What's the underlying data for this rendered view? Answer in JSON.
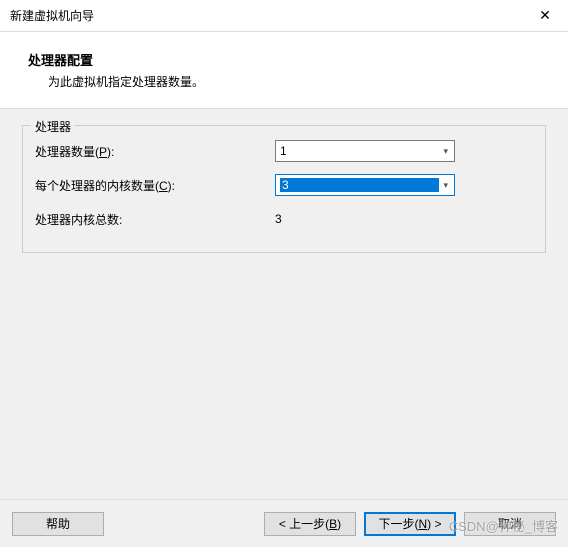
{
  "window": {
    "title": "新建虚拟机向导"
  },
  "header": {
    "title": "处理器配置",
    "subtitle": "为此虚拟机指定处理器数量。"
  },
  "group": {
    "label": "处理器",
    "rows": {
      "processors": {
        "label_prefix": "处理器数量(",
        "label_key": "P",
        "label_suffix": "):",
        "value": "1"
      },
      "cores": {
        "label_prefix": "每个处理器的内核数量(",
        "label_key": "C",
        "label_suffix": "):",
        "value": "3"
      },
      "total": {
        "label": "处理器内核总数:",
        "value": "3"
      }
    }
  },
  "footer": {
    "help": "帮助",
    "back_prefix": "< 上一步(",
    "back_key": "B",
    "back_suffix": ")",
    "next_prefix": "下一步(",
    "next_key": "N",
    "next_suffix": ") >",
    "cancel": "取消"
  },
  "watermark": "CSDN@神秘_博客"
}
